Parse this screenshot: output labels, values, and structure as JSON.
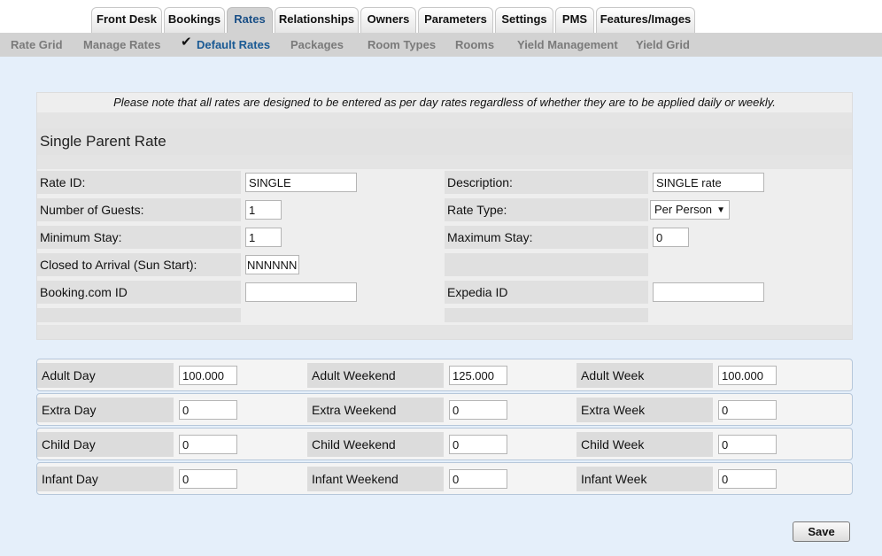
{
  "tabs": [
    {
      "label": "Front Desk"
    },
    {
      "label": "Bookings"
    },
    {
      "label": "Rates"
    },
    {
      "label": "Relationships"
    },
    {
      "label": "Owners"
    },
    {
      "label": "Parameters"
    },
    {
      "label": "Settings"
    },
    {
      "label": "PMS"
    },
    {
      "label": "Features/Images"
    }
  ],
  "active_tab": "Rates",
  "subnav": [
    {
      "label": "Rate Grid"
    },
    {
      "label": "Manage Rates"
    },
    {
      "label": "Default Rates"
    },
    {
      "label": "Packages"
    },
    {
      "label": "Room Types"
    },
    {
      "label": "Rooms"
    },
    {
      "label": "Yield Management"
    },
    {
      "label": "Yield Grid"
    }
  ],
  "active_subnav": "Default Rates",
  "note": "Please note that all rates are designed to be entered as per day rates regardless of whether they are to be applied daily or weekly.",
  "rate_title": "Single Parent Rate",
  "fields": {
    "rate_id": {
      "label": "Rate ID:",
      "value": "SINGLE"
    },
    "description": {
      "label": "Description:",
      "value": "SINGLE rate"
    },
    "num_guests": {
      "label": "Number of Guests:",
      "value": "1"
    },
    "rate_type": {
      "label": "Rate Type:",
      "value": "Per Person"
    },
    "min_stay": {
      "label": "Minimum Stay:",
      "value": "1"
    },
    "max_stay": {
      "label": "Maximum Stay:",
      "value": "0"
    },
    "closed_arrival": {
      "label": "Closed to Arrival (Sun Start):",
      "value": "NNNNNN"
    },
    "booking_id": {
      "label": "Booking.com ID",
      "value": ""
    },
    "expedia_id": {
      "label": "Expedia ID",
      "value": ""
    }
  },
  "amounts": [
    {
      "day_label": "Adult Day",
      "day_value": "100.000",
      "weekend_label": "Adult Weekend",
      "weekend_value": "125.000",
      "week_label": "Adult Week",
      "week_value": "100.000"
    },
    {
      "day_label": "Extra Day",
      "day_value": "0",
      "weekend_label": "Extra Weekend",
      "weekend_value": "0",
      "week_label": "Extra Week",
      "week_value": "0"
    },
    {
      "day_label": "Child Day",
      "day_value": "0",
      "weekend_label": "Child Weekend",
      "weekend_value": "0",
      "week_label": "Child Week",
      "week_value": "0"
    },
    {
      "day_label": "Infant Day",
      "day_value": "0",
      "weekend_label": "Infant Weekend",
      "weekend_value": "0",
      "week_label": "Infant Week",
      "week_value": "0"
    }
  ],
  "save_label": "Save",
  "colors": {
    "main_bg": "#e5effa",
    "subnav_bg": "#d2d2d2",
    "active_link": "#1a5a94"
  }
}
